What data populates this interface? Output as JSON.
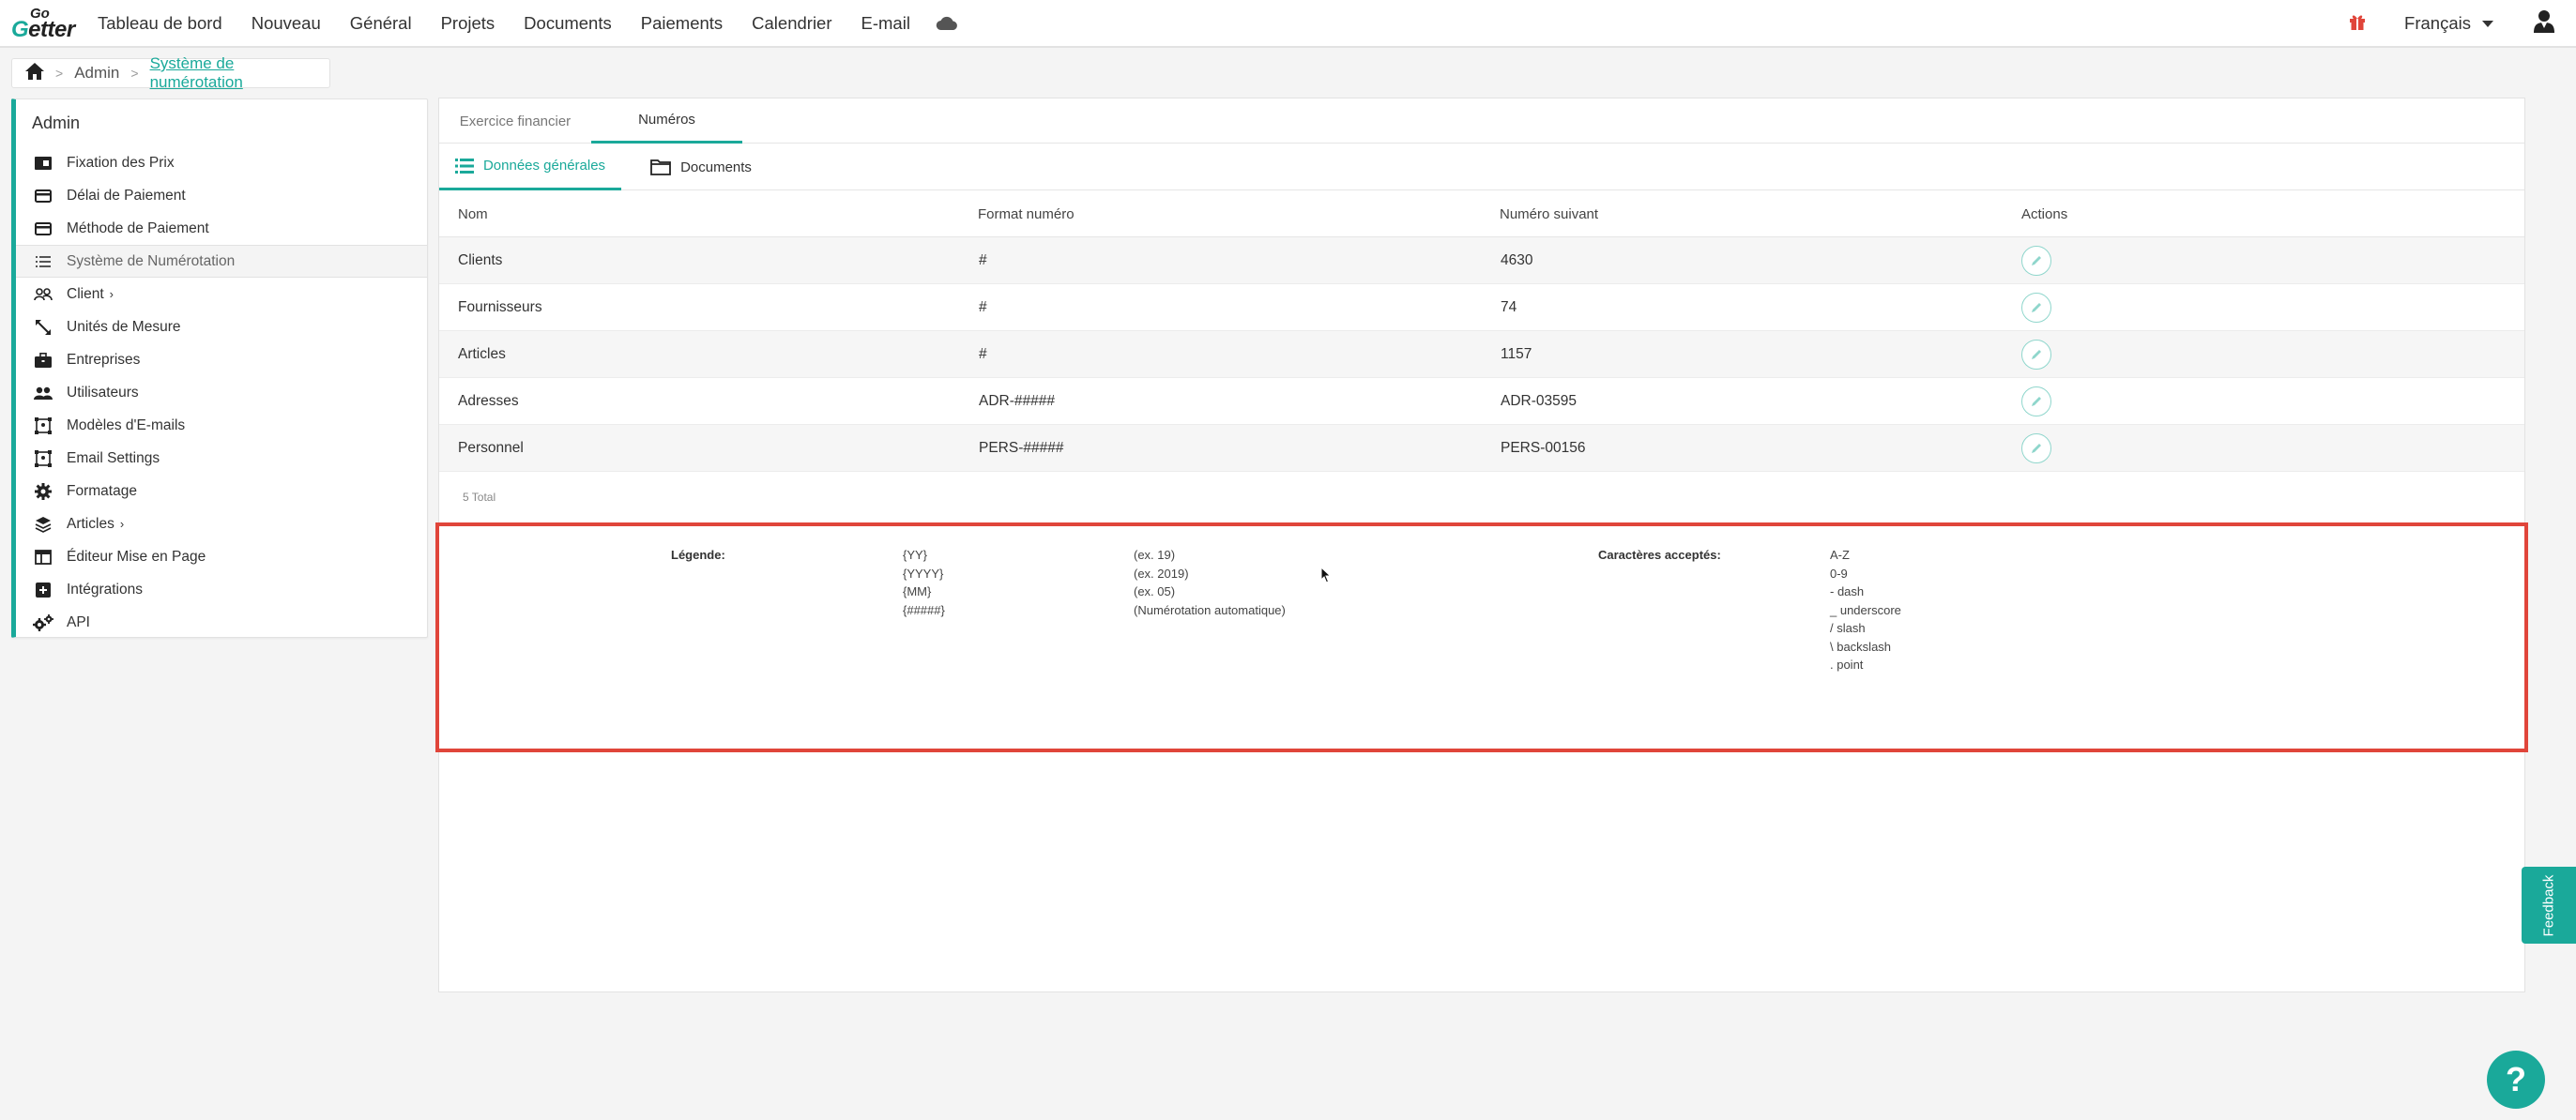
{
  "brand": {
    "logo_top": "Go",
    "logo_bottom": "Getter"
  },
  "nav": {
    "items": [
      "Tableau de bord",
      "Nouveau",
      "Général",
      "Projets",
      "Documents",
      "Paiements",
      "Calendrier",
      "E-mail"
    ],
    "language": "Français"
  },
  "breadcrumb": {
    "admin": "Admin",
    "current": "Système de numérotation"
  },
  "sidebar": {
    "title": "Admin",
    "items": [
      {
        "label": "Fixation des Prix",
        "icon": "price-tag-icon"
      },
      {
        "label": "Délai de Paiement",
        "icon": "credit-card-icon"
      },
      {
        "label": "Méthode de Paiement",
        "icon": "credit-card-icon"
      },
      {
        "label": "Système de Numérotation",
        "icon": "list-icon"
      },
      {
        "label": "Client",
        "icon": "people-icon"
      },
      {
        "label": "Unités de Mesure",
        "icon": "resize-icon"
      },
      {
        "label": "Entreprises",
        "icon": "briefcase-icon"
      },
      {
        "label": "Utilisateurs",
        "icon": "users-icon"
      },
      {
        "label": "Modèles d'E-mails",
        "icon": "template-icon"
      },
      {
        "label": "Email Settings",
        "icon": "template-icon"
      },
      {
        "label": "Formatage",
        "icon": "gear-icon"
      },
      {
        "label": "Articles",
        "icon": "layers-icon"
      },
      {
        "label": "Éditeur Mise en Page",
        "icon": "layout-icon"
      },
      {
        "label": "Intégrations",
        "icon": "plus-square-icon"
      },
      {
        "label": "API",
        "icon": "gears-icon"
      }
    ]
  },
  "tabs": {
    "financial_year": "Exercice financier",
    "numbers": "Numéros"
  },
  "subtabs": {
    "general": "Données générales",
    "documents": "Documents"
  },
  "table": {
    "headers": [
      "Nom",
      "Format numéro",
      "Numéro suivant",
      "Actions"
    ],
    "rows": [
      [
        "Clients",
        "#",
        "4630"
      ],
      [
        "Fournisseurs",
        "#",
        "74"
      ],
      [
        "Articles",
        "#",
        "1157"
      ],
      [
        "Adresses",
        "ADR-#####",
        "ADR-03595"
      ],
      [
        "Personnel",
        "PERS-#####",
        "PERS-00156"
      ]
    ],
    "total": "5 Total"
  },
  "legend": {
    "title": "Légende:",
    "codes": [
      "{YY}",
      "{YYYY}",
      "{MM}",
      "{#####}"
    ],
    "examples": [
      "(ex. 19)",
      "(ex. 2019)",
      "(ex. 05)",
      "(Numérotation automatique)"
    ],
    "accepted_title": "Caractères acceptés:",
    "accepted": [
      "A-Z",
      "0-9",
      "- dash",
      "_ underscore",
      "/ slash",
      "\\ backslash",
      ". point"
    ]
  },
  "feedback": "Feedback",
  "help": "?",
  "colors": {
    "accent": "#1aa99a",
    "highlight": "#e0453a"
  }
}
